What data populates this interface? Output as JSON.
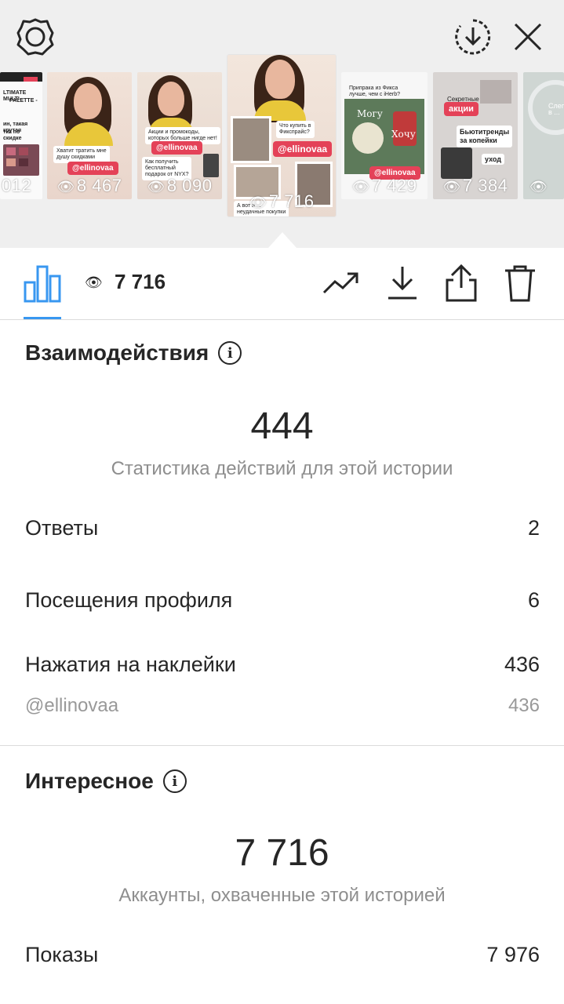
{
  "header": {
    "settings_icon": "gear-icon",
    "download_icon": "download-circle-icon",
    "close_icon": "close-icon"
  },
  "stories": [
    {
      "views": "012",
      "text": [
        "LTIMATE MULTI-",
        "PALETTE -",
        "ин, такая крутая",
        "тка по скидке"
      ]
    },
    {
      "views": "8 467",
      "text": [
        "Хватит тратить мне",
        "душу скидками"
      ],
      "tag": "@ellinovaa"
    },
    {
      "views": "8 090",
      "text": [
        "Акции и промокоды,",
        "которых больше нигде нет!",
        "Как получить",
        "бесплатный",
        "подарок от NYX?"
      ],
      "tag": "@ellinovaa"
    },
    {
      "views": "7 716",
      "text": [
        "Что купить в",
        "Фикспрайс?",
        "А вот и ...",
        "неудачные покупки"
      ],
      "tag": "@ellinovaa"
    },
    {
      "views": "7 429",
      "text": [
        "Припрака из Фикса",
        "лучше, чем с iHerb?",
        "Могу",
        "Хочу"
      ],
      "tag": "@ellinovaa"
    },
    {
      "views": "7 384",
      "text": [
        "Секретные",
        "акции",
        "Бьютитренды",
        "за копейки",
        "уход"
      ]
    },
    {
      "views": "",
      "text": [
        "Слеп",
        "в ..."
      ]
    }
  ],
  "toolbar": {
    "stats_icon": "bar-chart-icon",
    "eye_icon": "eye-icon",
    "view_count": "7 716",
    "promote_icon": "trending-up-icon",
    "save_icon": "download-icon",
    "share_icon": "share-icon",
    "delete_icon": "trash-icon"
  },
  "interactions": {
    "title": "Взаимодействия",
    "total": "444",
    "caption": "Статистика действий для этой истории",
    "rows": [
      {
        "label": "Ответы",
        "value": "2"
      },
      {
        "label": "Посещения профиля",
        "value": "6"
      },
      {
        "label": "Нажатия на наклейки",
        "value": "436"
      }
    ],
    "sticker": {
      "label": "@ellinovaa",
      "value": "436"
    }
  },
  "discovery": {
    "title": "Интересное",
    "total": "7 716",
    "caption": "Аккаунты, охваченные этой историей",
    "rows": [
      {
        "label": "Показы",
        "value": "7 976"
      }
    ]
  },
  "colors": {
    "accent": "#3897f0",
    "tag": "#e44258",
    "muted": "#8e8e8e",
    "divider": "#dbdbdb"
  }
}
